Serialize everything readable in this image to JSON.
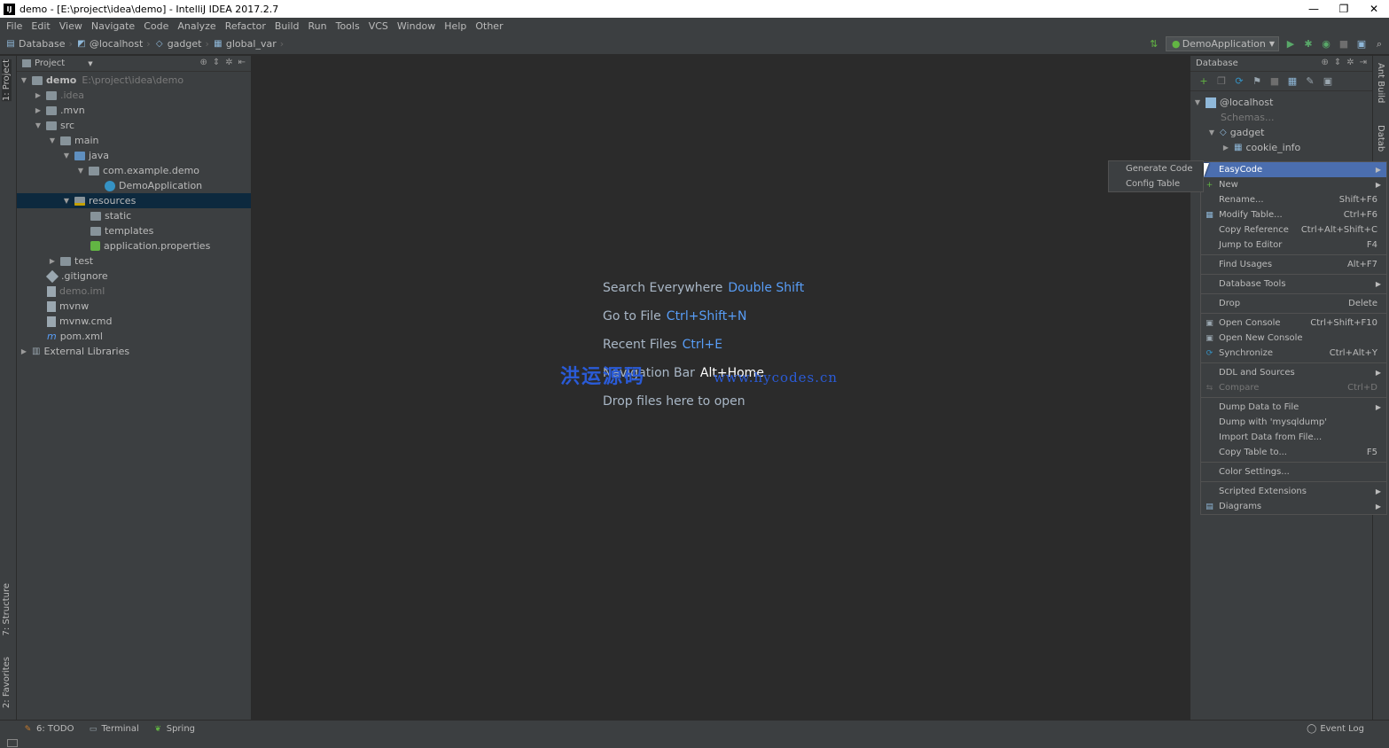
{
  "window": {
    "title": "demo - [E:\\project\\idea\\demo] - IntelliJ IDEA 2017.2.7",
    "app_icon": "IJ",
    "minimize": "—",
    "maximize": "❐",
    "close": "✕"
  },
  "menu": [
    "File",
    "Edit",
    "View",
    "Navigate",
    "Code",
    "Analyze",
    "Refactor",
    "Build",
    "Run",
    "Tools",
    "VCS",
    "Window",
    "Help",
    "Other"
  ],
  "breadcrumbs": [
    "Database",
    "@localhost",
    "gadget",
    "global_var"
  ],
  "run_config": "DemoApplication",
  "left_tabs": {
    "project": "1: Project",
    "structure": "7: Structure",
    "favorites": "2: Favorites"
  },
  "right_tabs": {
    "ant": "Ant Build",
    "database": "Datab"
  },
  "project_panel": {
    "title": "Project",
    "tree": [
      {
        "label": "demo",
        "extra": "E:\\project\\idea\\demo"
      },
      {
        "label": ".idea"
      },
      {
        "label": ".mvn"
      },
      {
        "label": "src"
      },
      {
        "label": "main"
      },
      {
        "label": "java"
      },
      {
        "label": "com.example.demo"
      },
      {
        "label": "DemoApplication"
      },
      {
        "label": "resources"
      },
      {
        "label": "static"
      },
      {
        "label": "templates"
      },
      {
        "label": "application.properties"
      },
      {
        "label": "test"
      },
      {
        "label": ".gitignore"
      },
      {
        "label": "demo.iml"
      },
      {
        "label": "mvnw"
      },
      {
        "label": "mvnw.cmd"
      },
      {
        "label": "pom.xml"
      },
      {
        "label": "External Libraries"
      }
    ]
  },
  "editor": {
    "hints": [
      {
        "text": "Search Everywhere",
        "key": "Double Shift"
      },
      {
        "text": "Go to File",
        "key": "Ctrl+Shift+N"
      },
      {
        "text": "Recent Files",
        "key": "Ctrl+E"
      },
      {
        "text": "Navigation Bar",
        "key": "Alt+Home"
      },
      {
        "text": "Drop files here to open",
        "key": ""
      }
    ],
    "watermark": "洪运源码",
    "watermark_url": "www.hycodes.cn"
  },
  "database_panel": {
    "title": "Database",
    "tree": [
      {
        "label": "@localhost"
      },
      {
        "label": "Schemas..."
      },
      {
        "label": "gadget"
      },
      {
        "label": "cookie_info"
      }
    ]
  },
  "context_menu": {
    "items": [
      {
        "label": "EasyCode",
        "shortcut": "",
        "submenu": true
      },
      {
        "label": "New",
        "shortcut": "",
        "submenu": true
      },
      {
        "label": "Rename...",
        "shortcut": "Shift+F6"
      },
      {
        "label": "Modify Table...",
        "shortcut": "Ctrl+F6"
      },
      {
        "label": "Copy Reference",
        "shortcut": "Ctrl+Alt+Shift+C"
      },
      {
        "label": "Jump to Editor",
        "shortcut": "F4"
      },
      {
        "label": "Find Usages",
        "shortcut": "Alt+F7"
      },
      {
        "label": "Database Tools",
        "shortcut": "",
        "submenu": true
      },
      {
        "label": "Drop",
        "shortcut": "Delete"
      },
      {
        "label": "Open Console",
        "shortcut": "Ctrl+Shift+F10"
      },
      {
        "label": "Open New Console",
        "shortcut": ""
      },
      {
        "label": "Synchronize",
        "shortcut": "Ctrl+Alt+Y"
      },
      {
        "label": "DDL and Sources",
        "shortcut": "",
        "submenu": true
      },
      {
        "label": "Compare",
        "shortcut": "Ctrl+D"
      },
      {
        "label": "Dump Data to File",
        "shortcut": "",
        "submenu": true
      },
      {
        "label": "Dump with 'mysqldump'",
        "shortcut": ""
      },
      {
        "label": "Import Data from File...",
        "shortcut": ""
      },
      {
        "label": "Copy Table to...",
        "shortcut": "F5"
      },
      {
        "label": "Color Settings...",
        "shortcut": ""
      },
      {
        "label": "Scripted Extensions",
        "shortcut": "",
        "submenu": true
      },
      {
        "label": "Diagrams",
        "shortcut": "",
        "submenu": true
      }
    ]
  },
  "easycode_submenu": [
    "Generate Code",
    "Config Table"
  ],
  "bottom_tools": [
    "6: TODO",
    "Terminal",
    "Spring"
  ],
  "event_log": "Event Log",
  "colors": {
    "accent": "#4b6eaf",
    "link": "#589df6",
    "bg": "#2b2b2b",
    "panel": "#3c3f41"
  }
}
